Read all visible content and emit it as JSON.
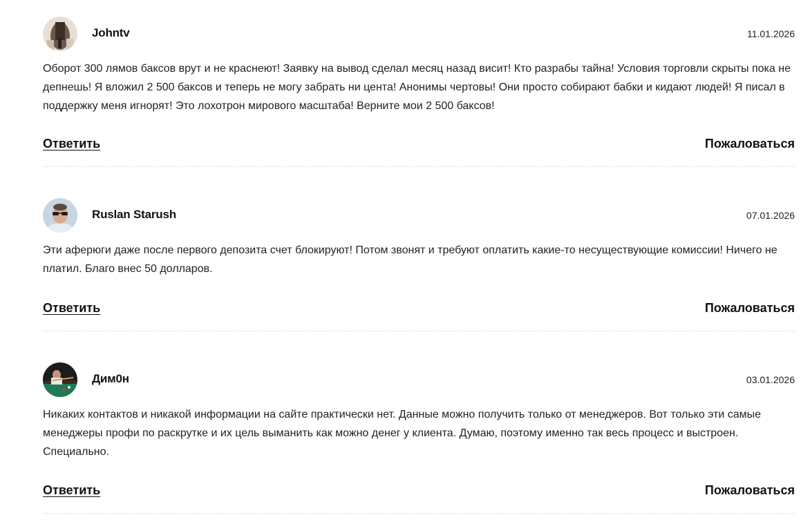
{
  "comments": [
    {
      "author": "Johntv",
      "date": "11.01.2026",
      "text": "Оборот 300 лямов баксов врут и не краснеют! Заявку на вывод сделал месяц назад висит! Кто разрабы тайна! Условия торговли скрыты пока не депнешь! Я вложил 2 500 баксов и теперь не могу забрать ни цента! Анонимы чертовы! Они просто собирают бабки и кидают людей! Я писал в поддержку меня игнорят! Это лохотрон мирового масштаба! Верните мои 2 500 баксов!",
      "reply_label": "Ответить",
      "report_label": "Пожаловаться"
    },
    {
      "author": "Ruslan Starush",
      "date": "07.01.2026",
      "text": "Эти аферюги даже после первого депозита счет блокируют! Потом звонят и требуют оплатить какие-то несуществующие комиссии! Ничего не платил. Благо внес 50 долларов.",
      "reply_label": "Ответить",
      "report_label": "Пожаловаться"
    },
    {
      "author": "Дим0н",
      "date": "03.01.2026",
      "text": "Никаких контактов и никакой информации на сайте практически нет. Данные можно получить только от менеджеров. Вот только эти самые менеджеры профи по раскрутке и их цель выманить как можно денег у клиента. Думаю, поэтому именно так весь процесс и выстроен. Специально.",
      "reply_label": "Ответить",
      "report_label": "Пожаловаться"
    }
  ]
}
